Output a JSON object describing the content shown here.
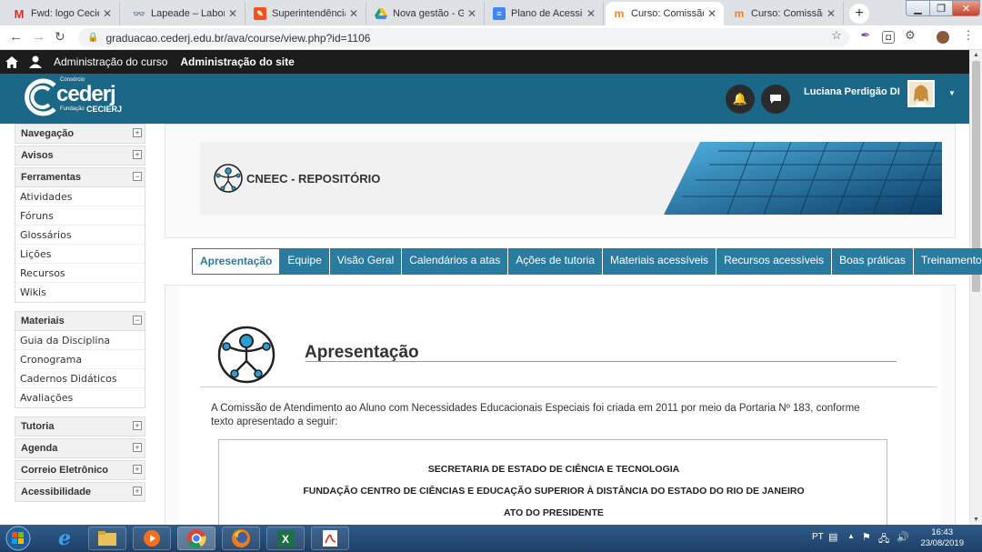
{
  "browser": {
    "tabs": [
      {
        "title": "Fwd: logo Cecierj - ",
        "favicon": "gmail-icon",
        "color": "#d93025"
      },
      {
        "title": "Lapeade – Laborató",
        "favicon": "glasses-icon",
        "color": "#333333"
      },
      {
        "title": "Superintendência d",
        "favicon": "pen-icon",
        "color": "#f4511e"
      },
      {
        "title": "Nova gestão - Goo",
        "favicon": "drive-icon",
        "color": "#1fa463"
      },
      {
        "title": "Plano de Acessibilid",
        "favicon": "docs-icon",
        "color": "#4285f4"
      },
      {
        "title": "Curso: Comissão N",
        "favicon": "moodle-icon",
        "color": "#f98012"
      },
      {
        "title": "Curso: Comissão N",
        "favicon": "moodle-icon",
        "color": "#f98012"
      }
    ],
    "active_tab": 5,
    "url": "graduacao.cederj.edu.br/ava/course/view.php?id=1106"
  },
  "topbar": {
    "course_admin": "Administração do curso",
    "site_admin": "Administração do site"
  },
  "header": {
    "logo_small_top": "Consórcio",
    "logo_main": "cederj",
    "logo_small_bottom": "Fundação",
    "logo_cecierj": "CECIERJ",
    "user_name": "Luciana Perdigão DI"
  },
  "sidebar": {
    "blocks": [
      {
        "title": "Navegação",
        "toggle": "+"
      },
      {
        "title": "Avisos",
        "toggle": "+"
      },
      {
        "title": "Ferramentas",
        "toggle": "−",
        "items": [
          "Atividades",
          "Fóruns",
          "Glossários",
          "Lições",
          "Recursos",
          "Wikis"
        ]
      },
      {
        "title": "Materiais",
        "toggle": "−",
        "items": [
          "Guia da Disciplina",
          "Cronograma",
          "Cadernos Didáticos",
          "Avaliações"
        ]
      },
      {
        "title": "Tutoria",
        "toggle": "+"
      },
      {
        "title": "Agenda",
        "toggle": "+"
      },
      {
        "title": "Correio Eletrônico",
        "toggle": "+"
      },
      {
        "title": "Acessibilidade",
        "toggle": "+"
      }
    ]
  },
  "banner": {
    "title": "CNEEC - REPOSITÓRIO"
  },
  "course_tabs": [
    "Apresentação",
    "Equipe",
    "Visão Geral",
    "Calendários a atas",
    "Ações de tutoria",
    "Materiais acessíveis",
    "Recursos acessíveis",
    "Boas práticas",
    "Treinamentos"
  ],
  "main": {
    "heading": "Apresentação",
    "intro": "A Comissão de Atendimento ao Aluno com Necessidades Educacionais Especiais foi criada em 2011 por meio da Portaria Nº 183, conforme texto apresentado a seguir:",
    "doc_lines": [
      "SECRETARIA DE ESTADO DE CIÊNCIA E TECNOLOGIA",
      "FUNDAÇÃO CENTRO DE CIÊNCIAS E EDUCAÇÃO SUPERIOR À DISTÂNCIA DO ESTADO DO RIO DE JANEIRO",
      "ATO DO PRESIDENTE"
    ]
  },
  "taskbar": {
    "lang": "PT",
    "time": "16:43",
    "date": "23/08/2019"
  },
  "colors": {
    "header": "#1a6787",
    "tab": "#2a7ba0",
    "topbar": "#1c1c1c"
  }
}
